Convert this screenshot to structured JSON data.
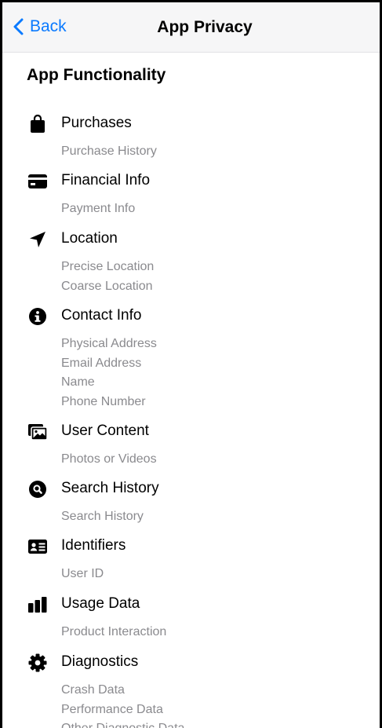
{
  "nav": {
    "back_label": "Back",
    "title": "App Privacy"
  },
  "section": {
    "heading": "App Functionality"
  },
  "categories": [
    {
      "icon": "shopping-bag-icon",
      "label": "Purchases",
      "items": [
        "Purchase History"
      ]
    },
    {
      "icon": "credit-card-icon",
      "label": "Financial Info",
      "items": [
        "Payment Info"
      ]
    },
    {
      "icon": "location-arrow-icon",
      "label": "Location",
      "items": [
        "Precise Location",
        "Coarse Location"
      ]
    },
    {
      "icon": "info-circle-icon",
      "label": "Contact Info",
      "items": [
        "Physical Address",
        "Email Address",
        "Name",
        "Phone Number"
      ]
    },
    {
      "icon": "photos-icon",
      "label": "User Content",
      "items": [
        "Photos or Videos"
      ]
    },
    {
      "icon": "search-circle-icon",
      "label": "Search History",
      "items": [
        "Search History"
      ]
    },
    {
      "icon": "id-card-icon",
      "label": "Identifiers",
      "items": [
        "User ID"
      ]
    },
    {
      "icon": "bar-chart-icon",
      "label": "Usage Data",
      "items": [
        "Product Interaction"
      ]
    },
    {
      "icon": "gear-icon",
      "label": "Diagnostics",
      "items": [
        "Crash Data",
        "Performance Data",
        "Other Diagnostic Data"
      ]
    }
  ],
  "colors": {
    "accent": "#0a7aff",
    "secondary_text": "#8a8a8e",
    "navbar_bg": "#f6f6f7"
  }
}
